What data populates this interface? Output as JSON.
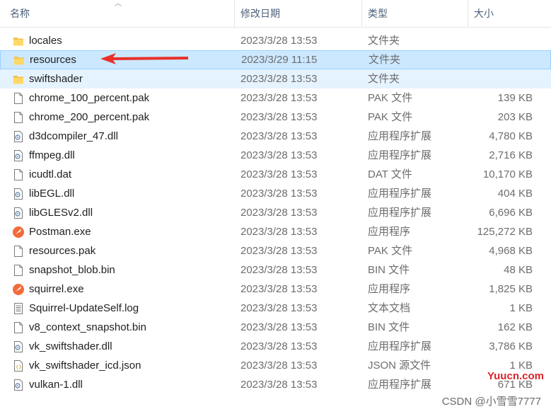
{
  "columns": {
    "name": "名称",
    "date": "修改日期",
    "type": "类型",
    "size": "大小"
  },
  "rows": [
    {
      "name": "locales",
      "date": "2023/3/28 13:53",
      "type": "文件夹",
      "size": "",
      "icon": "folder"
    },
    {
      "name": "resources",
      "date": "2023/3/29 11:15",
      "type": "文件夹",
      "size": "",
      "icon": "folder",
      "state": "selected"
    },
    {
      "name": "swiftshader",
      "date": "2023/3/28 13:53",
      "type": "文件夹",
      "size": "",
      "icon": "folder",
      "state": "hover"
    },
    {
      "name": "chrome_100_percent.pak",
      "date": "2023/3/28 13:53",
      "type": "PAK 文件",
      "size": "139 KB",
      "icon": "file"
    },
    {
      "name": "chrome_200_percent.pak",
      "date": "2023/3/28 13:53",
      "type": "PAK 文件",
      "size": "203 KB",
      "icon": "file"
    },
    {
      "name": "d3dcompiler_47.dll",
      "date": "2023/3/28 13:53",
      "type": "应用程序扩展",
      "size": "4,780 KB",
      "icon": "dll"
    },
    {
      "name": "ffmpeg.dll",
      "date": "2023/3/28 13:53",
      "type": "应用程序扩展",
      "size": "2,716 KB",
      "icon": "dll"
    },
    {
      "name": "icudtl.dat",
      "date": "2023/3/28 13:53",
      "type": "DAT 文件",
      "size": "10,170 KB",
      "icon": "file"
    },
    {
      "name": "libEGL.dll",
      "date": "2023/3/28 13:53",
      "type": "应用程序扩展",
      "size": "404 KB",
      "icon": "dll"
    },
    {
      "name": "libGLESv2.dll",
      "date": "2023/3/28 13:53",
      "type": "应用程序扩展",
      "size": "6,696 KB",
      "icon": "dll"
    },
    {
      "name": "Postman.exe",
      "date": "2023/3/28 13:53",
      "type": "应用程序",
      "size": "125,272 KB",
      "icon": "app"
    },
    {
      "name": "resources.pak",
      "date": "2023/3/28 13:53",
      "type": "PAK 文件",
      "size": "4,968 KB",
      "icon": "file"
    },
    {
      "name": "snapshot_blob.bin",
      "date": "2023/3/28 13:53",
      "type": "BIN 文件",
      "size": "48 KB",
      "icon": "file"
    },
    {
      "name": "squirrel.exe",
      "date": "2023/3/28 13:53",
      "type": "应用程序",
      "size": "1,825 KB",
      "icon": "app"
    },
    {
      "name": "Squirrel-UpdateSelf.log",
      "date": "2023/3/28 13:53",
      "type": "文本文档",
      "size": "1 KB",
      "icon": "text"
    },
    {
      "name": "v8_context_snapshot.bin",
      "date": "2023/3/28 13:53",
      "type": "BIN 文件",
      "size": "162 KB",
      "icon": "file"
    },
    {
      "name": "vk_swiftshader.dll",
      "date": "2023/3/28 13:53",
      "type": "应用程序扩展",
      "size": "3,786 KB",
      "icon": "dll"
    },
    {
      "name": "vk_swiftshader_icd.json",
      "date": "2023/3/28 13:53",
      "type": "JSON 源文件",
      "size": "1 KB",
      "icon": "json"
    },
    {
      "name": "vulkan-1.dll",
      "date": "2023/3/28 13:53",
      "type": "应用程序扩展",
      "size": "671 KB",
      "icon": "dll"
    }
  ],
  "annotation": {
    "arrow_color": "#e8312a",
    "target": "resources"
  },
  "watermarks": {
    "site": "Yuucn.com",
    "author": "CSDN @小雪雪7777"
  },
  "colors": {
    "folder": "#f0c24b",
    "selected_bg": "#cce8ff",
    "hover_bg": "#e5f3ff",
    "app_icon": "#f26b3a"
  }
}
